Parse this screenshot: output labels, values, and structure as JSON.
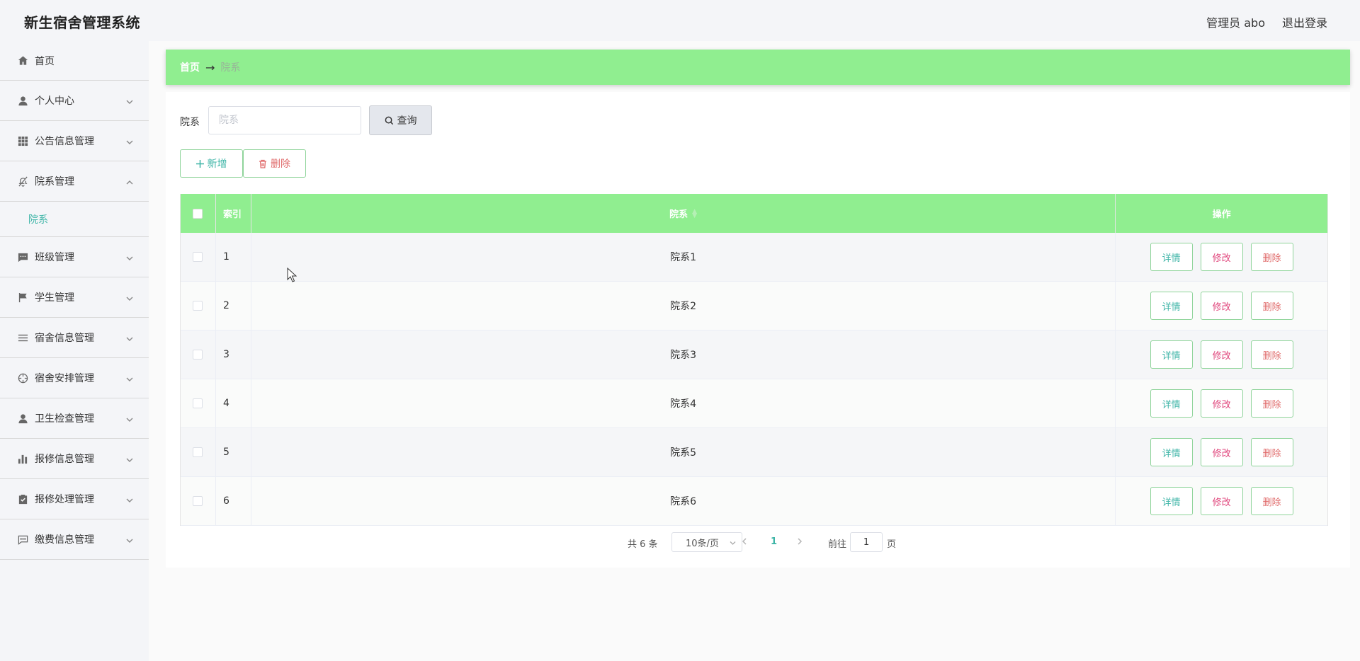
{
  "app": {
    "title": "新生宿舍管理系统",
    "user_label": "管理员 abo",
    "logout_label": "退出登录"
  },
  "sidebar": {
    "items": [
      {
        "label": "首页",
        "icon": "home-icon"
      },
      {
        "label": "个人中心",
        "icon": "user-icon"
      },
      {
        "label": "公告信息管理",
        "icon": "grid-icon"
      },
      {
        "label": "院系管理",
        "icon": "bell-off-icon",
        "expanded": true
      },
      {
        "label": "班级管理",
        "icon": "chat-icon"
      },
      {
        "label": "学生管理",
        "icon": "flag-icon"
      },
      {
        "label": "宿舍信息管理",
        "icon": "list-icon"
      },
      {
        "label": "宿舍安排管理",
        "icon": "crosshair-icon"
      },
      {
        "label": "卫生检查管理",
        "icon": "user-icon"
      },
      {
        "label": "报修信息管理",
        "icon": "bar-chart-icon"
      },
      {
        "label": "报修处理管理",
        "icon": "clipboard-check-icon"
      },
      {
        "label": "缴费信息管理",
        "icon": "message-icon"
      }
    ],
    "submenu_label": "院系"
  },
  "breadcrumb": {
    "home": "首页",
    "arrow": "→",
    "current": "院系"
  },
  "search": {
    "label": "院系",
    "placeholder": "院系",
    "value": "",
    "button_label": "查询"
  },
  "actions": {
    "add_label": "新增",
    "delete_label": "删除"
  },
  "table": {
    "columns": [
      "索引",
      "院系",
      "操作"
    ],
    "rows": [
      {
        "index": "1",
        "name": "院系1"
      },
      {
        "index": "2",
        "name": "院系2"
      },
      {
        "index": "3",
        "name": "院系3"
      },
      {
        "index": "4",
        "name": "院系4"
      },
      {
        "index": "5",
        "name": "院系5"
      },
      {
        "index": "6",
        "name": "院系6"
      }
    ],
    "row_actions": {
      "detail": "详情",
      "edit": "修改",
      "delete": "删除"
    }
  },
  "pagination": {
    "total_text": "共 6 条",
    "page_size": "10条/页",
    "current_page": "1",
    "goto_label": "前往",
    "goto_value": "1",
    "page_unit": "页"
  },
  "colors": {
    "accent_green": "#90ee90",
    "teal": "#3cb4a6",
    "pink": "#e0467c",
    "red": "#e06b6b"
  }
}
